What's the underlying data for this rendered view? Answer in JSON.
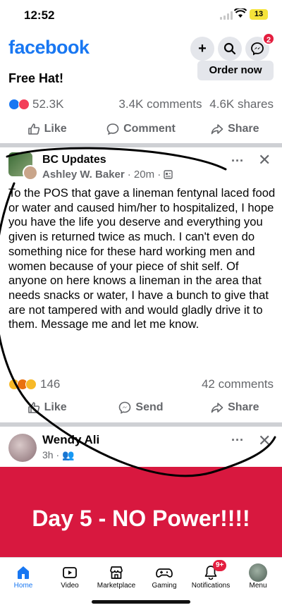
{
  "status_bar": {
    "time": "12:52",
    "battery": "13"
  },
  "header": {
    "brand": "facebook",
    "messenger_badge": "2"
  },
  "ad": {
    "title": "Free Hat!",
    "cta": "Order now",
    "reaction_count": "52.3K",
    "comments": "3.4K comments",
    "shares": "4.6K shares",
    "actions": {
      "like": "Like",
      "comment": "Comment",
      "share": "Share"
    }
  },
  "post": {
    "group": "BC Updates",
    "author": "Ashley W. Baker",
    "time": "· 20m ·",
    "text": "To the POS that gave a lineman fentynal laced food or water and caused him/her to hospitalized, I hope you have the life you deserve and everything you given is returned twice as much.  I can't even do something nice for these hard working men and women because of your piece of shit self. Of anyone on here knows a lineman in the area that needs snacks or water, I have a bunch to give that are not tampered with and would gladly drive it to them. Message me and let me know.",
    "reaction_count": "146",
    "comments": "42 comments",
    "actions": {
      "like": "Like",
      "send": "Send",
      "share": "Share"
    }
  },
  "post2": {
    "author": "Wendy Ali",
    "time": "3h ·",
    "banner_text": "Day 5 - NO Power!!!!",
    "banner_color": "#d8183f"
  },
  "bottom_nav": {
    "items": [
      {
        "label": "Home",
        "icon": "home-icon"
      },
      {
        "label": "Video",
        "icon": "video-icon"
      },
      {
        "label": "Marketplace",
        "icon": "marketplace-icon"
      },
      {
        "label": "Gaming",
        "icon": "gaming-icon"
      },
      {
        "label": "Notifications",
        "icon": "bell-icon"
      },
      {
        "label": "Menu",
        "icon": "avatar-icon"
      }
    ],
    "notification_badge": "9+"
  },
  "colors": {
    "brand": "#1877f2",
    "muted": "#65676b",
    "badge": "#e41e3f"
  }
}
